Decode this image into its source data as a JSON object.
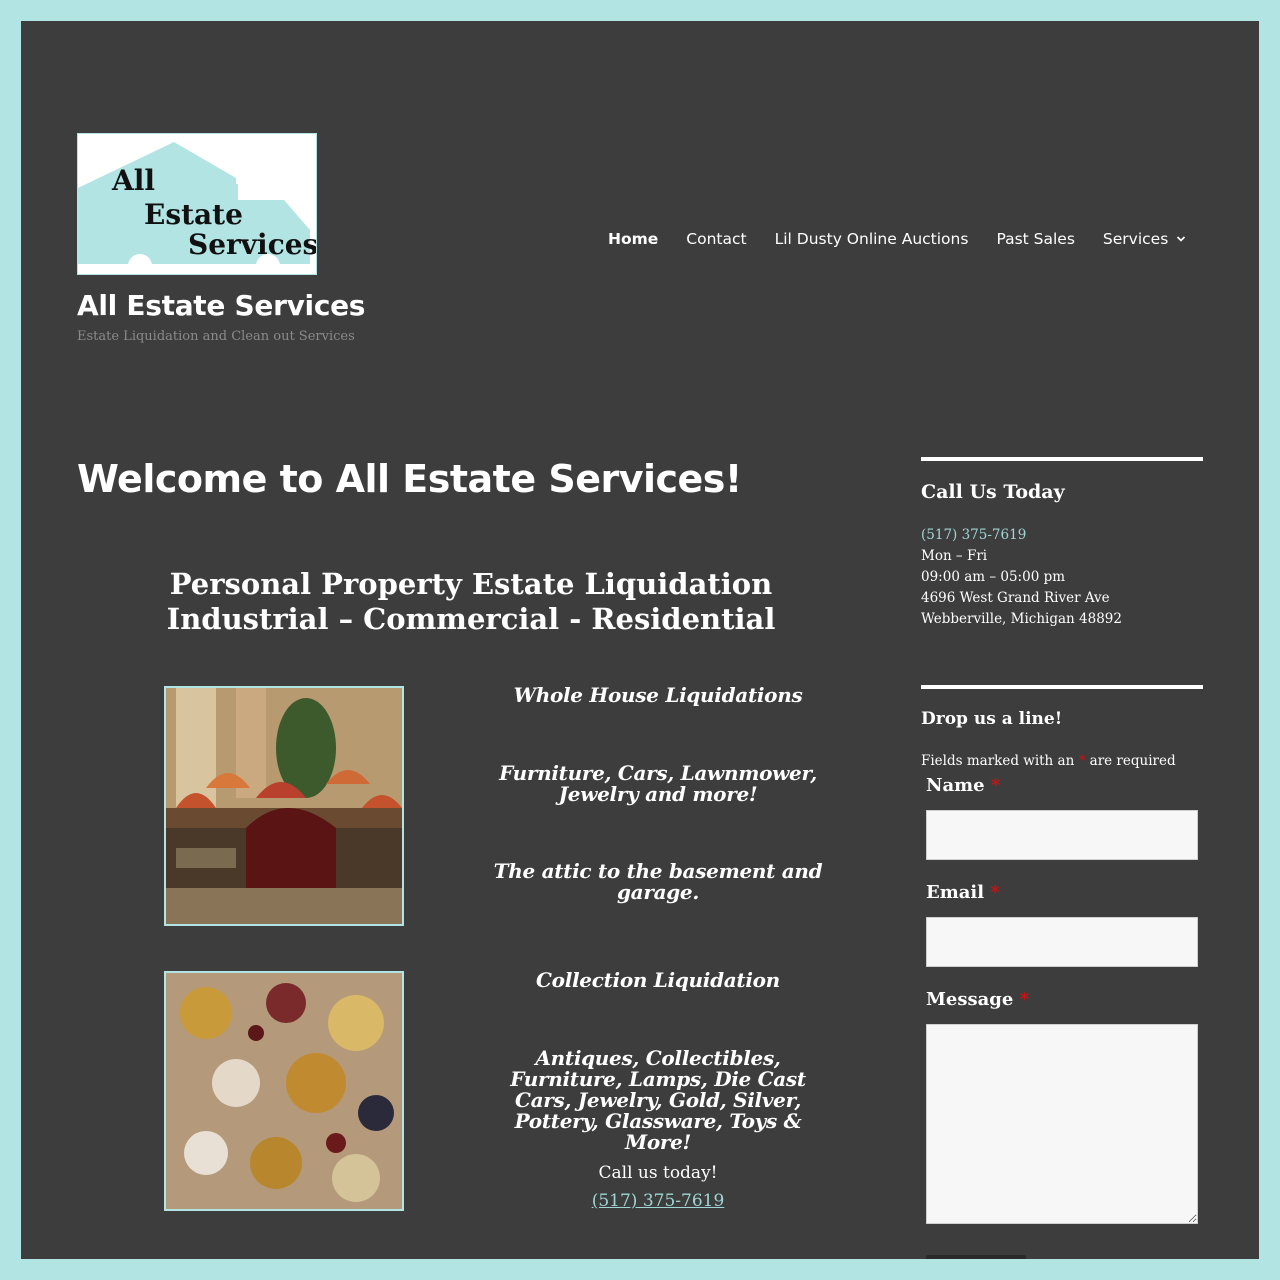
{
  "brand": {
    "logo_lines": [
      "All",
      "Estate",
      "Services"
    ],
    "site_title": "All Estate Services",
    "tagline": "Estate Liquidation and Clean out Services",
    "accent_color": "#b1e4e3"
  },
  "nav": {
    "items": [
      "Home",
      "Contact",
      "Lil Dusty Online Auctions",
      "Past Sales",
      "Services"
    ],
    "active": "Home"
  },
  "main": {
    "heading": "Welcome to All Estate Services!",
    "subhead_line1": "Personal Property Estate Liquidation",
    "subhead_line2": "Industrial – Commercial - Residential",
    "block1": {
      "photo_icon": "tiffany-lamps-photo",
      "title": "Whole House Liquidations",
      "items": "Furniture, Cars, Lawnmower, Jewelry and more!",
      "note": "The attic to the basement and garage."
    },
    "block2": {
      "photo_icon": "jewelry-photo",
      "title": "Collection Liquidation",
      "items": "Antiques, Collectibles, Furniture, Lamps, Die Cast Cars, Jewelry, Gold, Silver, Pottery, Glassware, Toys & More!"
    },
    "call_text": "Call us today!",
    "call_phone": "(517) 375-7619"
  },
  "sidebar": {
    "contact_widget": {
      "title": "Call Us Today",
      "phone": "(517) 375-7619",
      "days": "Mon – Fri",
      "hours": "09:00 am – 05:00 pm",
      "address1": "4696 West Grand River Ave",
      "address2": "Webberville, Michigan 48892"
    },
    "form_widget": {
      "title": "Drop us a line!",
      "required_note_before": "Fields marked with an",
      "required_star": "*",
      "required_note_after": "are required",
      "name_label": "Name",
      "email_label": "Email",
      "message_label": "Message"
    }
  }
}
